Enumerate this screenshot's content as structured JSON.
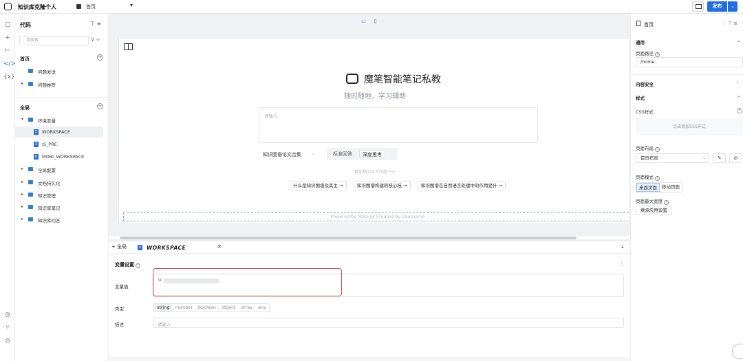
{
  "app": {
    "title": "知识库克隆个人",
    "page_selector": "首页",
    "publish_label": "发布"
  },
  "left_panel": {
    "title": "代码",
    "search_placeholder": "请搜索",
    "sections": [
      {
        "label": "首页",
        "items": [
          "问题发送",
          "问题推荐"
        ]
      },
      {
        "label": "全局",
        "items": [
          "环境变量",
          "WORKSPACE",
          "IS_PRE",
          "MOBI_WORKSPACE",
          "全局配置",
          "文档持久化",
          "知识管理",
          "知识库笔记",
          "知识库问答"
        ]
      }
    ]
  },
  "preview": {
    "brand": "魔笔智能笔记私教",
    "subtitle": "随时随地，学习辅助",
    "input_placeholder": "请输入",
    "kb_select": "知识图谱论文合集",
    "modes": [
      "标准回答",
      "深度思考"
    ],
    "hint": "猜你想问以下问题一一",
    "suggestions": [
      "什么是知识图谱及其主 →",
      "知识图谱构建的核心技 →",
      "知识图谱在自然语言处理中的作用是什 →"
    ],
    "footer": "Powered by Mobi @ Created by Username"
  },
  "bottom_panel": {
    "tab_add": "+ 全局",
    "tab_label": "WORKSPACE",
    "section_title": "变量设置",
    "value_label": "变量值",
    "value_text": "U",
    "type_label": "类型",
    "types": [
      "string",
      "number",
      "boolean",
      "object",
      "array",
      "any"
    ],
    "desc_label": "描述",
    "desc_placeholder": "请输入"
  },
  "right_panel": {
    "title": "首页",
    "general": "通用",
    "path_label": "页面路径",
    "path_value": "/home",
    "content_security": "内容安全",
    "style": "样式",
    "css_label": "CSS样式",
    "css_add": "点击添加CSS样式",
    "layout_label": "页面布局",
    "layout_value": "首页布局",
    "mode_label": "页面模式",
    "modes": [
      "桌面页面",
      "移动页面"
    ],
    "max_width_label": "页面最大宽度",
    "inherit_label": "继承应用设置"
  }
}
